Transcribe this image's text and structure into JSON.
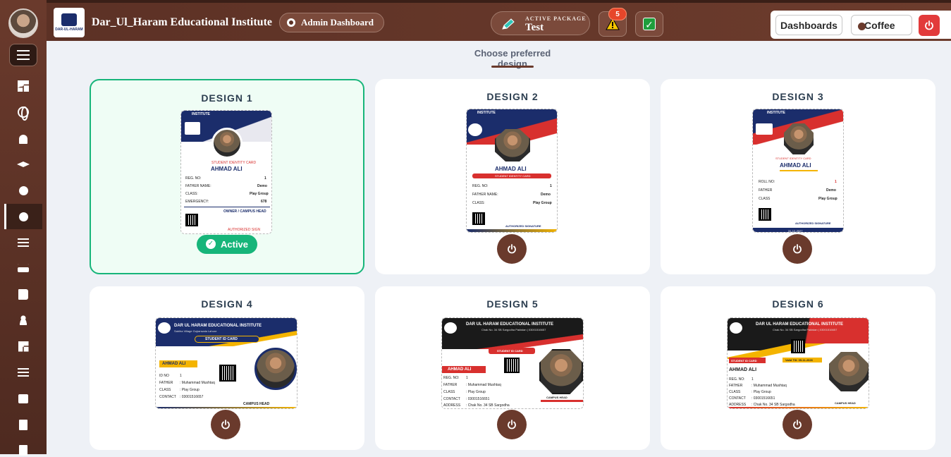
{
  "topbar": {
    "institute_name": "Dar_Ul_Haram Educational Institute",
    "admin_label": "Admin Dashboard",
    "package_label": "ACTIVE PACKAGE",
    "package_value": "Test",
    "alert_count": "5",
    "dashboards_label": "Dashboards",
    "theme_label": "Coffee"
  },
  "page": {
    "heading": "Choose preferred design",
    "active_label": "Active"
  },
  "designs": [
    {
      "title": "DESIGN 1",
      "status": "active"
    },
    {
      "title": "DESIGN 2",
      "status": "inactive"
    },
    {
      "title": "DESIGN 3",
      "status": "inactive"
    },
    {
      "title": "DESIGN 4",
      "status": "inactive"
    },
    {
      "title": "DESIGN 5",
      "status": "inactive"
    },
    {
      "title": "DESIGN 6",
      "status": "inactive"
    }
  ],
  "card_preview": {
    "school": "DAR UL HARAM EDUCATIONAL INSTITUTE",
    "school_short": "INSTITUTE",
    "student_name": "AHMAD ALI",
    "card_label": "STUDENT IDENTITY CARD",
    "card_label_short": "STUDENT ID CARD",
    "reg_no": "REG. NO:",
    "roll_no": "ROLL NO:",
    "id_no": "ID NO",
    "reg_val": "1",
    "father_label": "FATHER NAME:",
    "father_short": "FATHER",
    "father_val": "Demo",
    "father_full": ": Muhammad Mushtaq",
    "class_label": "CLASS:",
    "class_short": "CLASS",
    "class_val": "Play Group",
    "class_val2": ": Play Group",
    "emergency_label": "EMERGENCY:",
    "emergency_val": "678",
    "contact_label": "CONTACT",
    "contact_val": ": 03001516651",
    "contact_val4": ": 03001516657",
    "address_label": "ADDRESS",
    "address_val": ": Chak No. 34 SB Sargodha",
    "owner_label": "OWNER / CAMPUS HEAD",
    "auth_label": "AUTHORIZED SIGN",
    "auth_sig": "AUTHORIZED SIGNATURE",
    "campus_head": "CAMPUS HEAD",
    "valid": "Valid Till: 05-11-2026",
    "address_line": "Chak No. 34 SB Sargodha Pakistan | 03001516657",
    "sub_line": "Sabiha Village Gujranwala Lahore",
    "year": "31-12-2027"
  },
  "colors": {
    "brand": "#6a3a2c",
    "active_green": "#17b57a",
    "card_navy": "#1b2d6b",
    "card_red": "#d8302e",
    "card_yellow": "#f4b400"
  }
}
